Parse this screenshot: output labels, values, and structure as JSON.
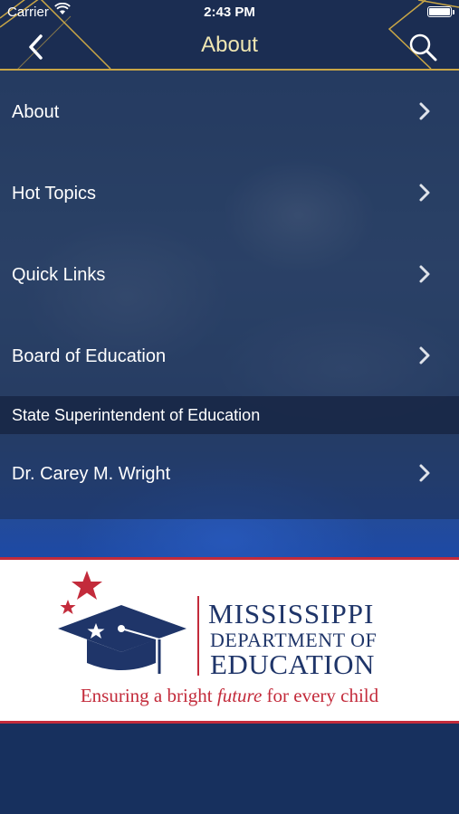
{
  "status_bar": {
    "carrier": "Carrier",
    "time": "2:43 PM"
  },
  "nav": {
    "title": "About",
    "back_icon": "back-chevron-icon",
    "search_icon": "search-icon"
  },
  "menu": {
    "items": [
      {
        "label": "About"
      },
      {
        "label": "Hot Topics"
      },
      {
        "label": "Quick Links"
      },
      {
        "label": "Board of Education"
      }
    ],
    "section_header": "State Superintendent of Education",
    "section_items": [
      {
        "label": "Dr. Carey M. Wright"
      }
    ]
  },
  "logo": {
    "line1": "MISSISSIPPI",
    "line2": "DEPARTMENT OF",
    "line3": "EDUCATION",
    "tagline_start": "Ensuring a bright ",
    "tagline_emphasis": "future",
    "tagline_end": " for every child"
  },
  "colors": {
    "nav_background": "#1b2d52",
    "accent_gold": "#c9a646",
    "brand_navy": "#1f3569",
    "brand_red": "#c32b3b"
  }
}
